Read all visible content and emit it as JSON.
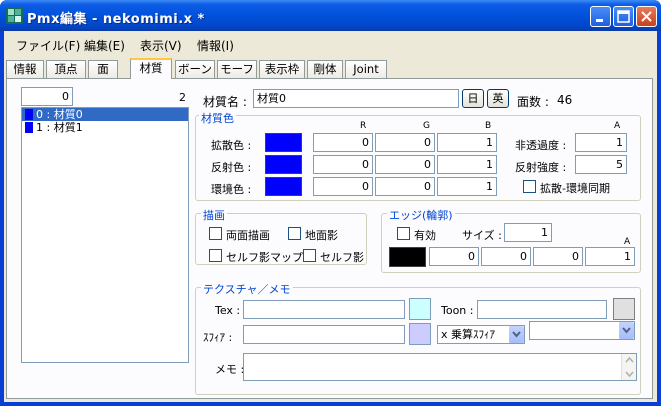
{
  "window": {
    "title": "Pmx編集 - nekomimi.x *",
    "controls": {
      "minimize": "minimize-icon",
      "maximize": "maximize-icon",
      "close": "close-icon"
    }
  },
  "menu": [
    "ファイル(F)",
    "編集(E)",
    "表示(V)",
    "情報(I)"
  ],
  "tabs": [
    "情報",
    "頂点",
    "面",
    "材質",
    "ボーン",
    "モーフ",
    "表示枠",
    "剛体",
    "Joint"
  ],
  "active_tab": "材質",
  "list": {
    "index_value": "0",
    "count": "2",
    "items": [
      "0 : 材質0",
      "1 : 材質1"
    ],
    "selected": 0
  },
  "material": {
    "name_label": "材質名 :",
    "name_value": "材質0",
    "jp_button": "日",
    "en_button": "英",
    "face_count_label": "面数 :",
    "face_count": "46"
  },
  "color_group": {
    "title": "材質色",
    "col_r": "R",
    "col_g": "G",
    "col_b": "B",
    "col_a": "A",
    "diffuse_label": "拡散色 :",
    "diffuse": [
      "0",
      "0",
      "1"
    ],
    "specular_label": "反射色 :",
    "specular": [
      "0",
      "0",
      "1"
    ],
    "ambient_label": "環境色 :",
    "ambient": [
      "0",
      "0",
      "1"
    ],
    "opacity_label": "非透過度 :",
    "opacity": "1",
    "specular_power_label": "反射強度 :",
    "specular_power": "5",
    "sync_label": "拡散-環境同期",
    "swatch_color": "#0000ff"
  },
  "draw_group": {
    "title": "描画",
    "double_sided": "両面描画",
    "ground_shadow": "地面影",
    "self_shadow_map": "セルフ影マップ",
    "self_shadow": "セルフ影"
  },
  "edge_group": {
    "title": "エッジ(輪郭)",
    "enabled_label": "有効",
    "size_label": "サイズ :",
    "size_value": "1",
    "col_a": "A",
    "rgba": [
      "0",
      "0",
      "0",
      "1"
    ],
    "swatch_color": "#000000"
  },
  "texture_group": {
    "title": "テクスチャ／メモ",
    "tex_label": "Tex :",
    "tex_value": "",
    "toon_label": "Toon :",
    "toon_value": "",
    "sphere_label": "ｽﾌｨｱ :",
    "sphere_value": "",
    "sphere_mode": "x 乗算ｽﾌｨｱ",
    "toon_select": "",
    "memo_label": "メモ :",
    "memo_value": "",
    "tex_color": "#ccffff",
    "sphere_color": "#ccccff",
    "toon_color": "#e0e0e0"
  }
}
